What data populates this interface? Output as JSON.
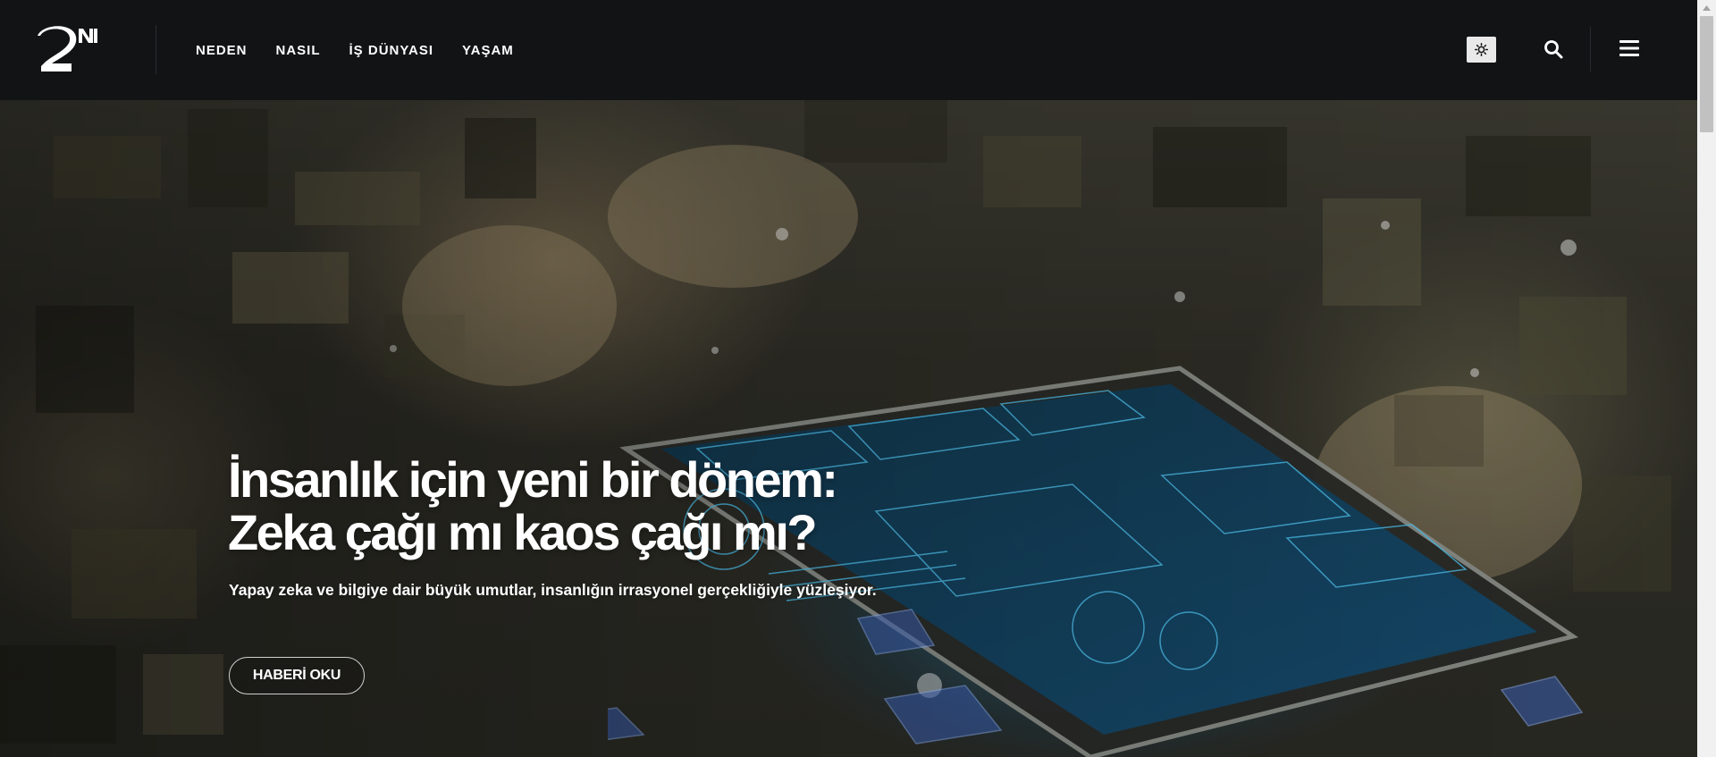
{
  "header": {
    "logo_alt": "2N",
    "nav": [
      {
        "label": "NEDEN"
      },
      {
        "label": "NASIL"
      },
      {
        "label": "İŞ DÜNYASI"
      },
      {
        "label": "YAŞAM"
      }
    ],
    "icons": {
      "theme": "sun-icon",
      "search": "search-icon",
      "menu": "hamburger-menu-icon"
    }
  },
  "hero": {
    "headline_line1": "İnsanlık için yeni bir dönem:",
    "headline_line2": "Zeka çağı mı kaos çağı mı?",
    "subtitle": "Yapay zeka ve bilgiye dair büyük umutlar, insanlığın irrasyonel gerçekliğiyle yüzleşiyor.",
    "cta_label": "HABERİ OKU"
  },
  "colors": {
    "header_bg": "#121315",
    "text": "#ffffff",
    "holo_blue": "#3aa7d8"
  }
}
